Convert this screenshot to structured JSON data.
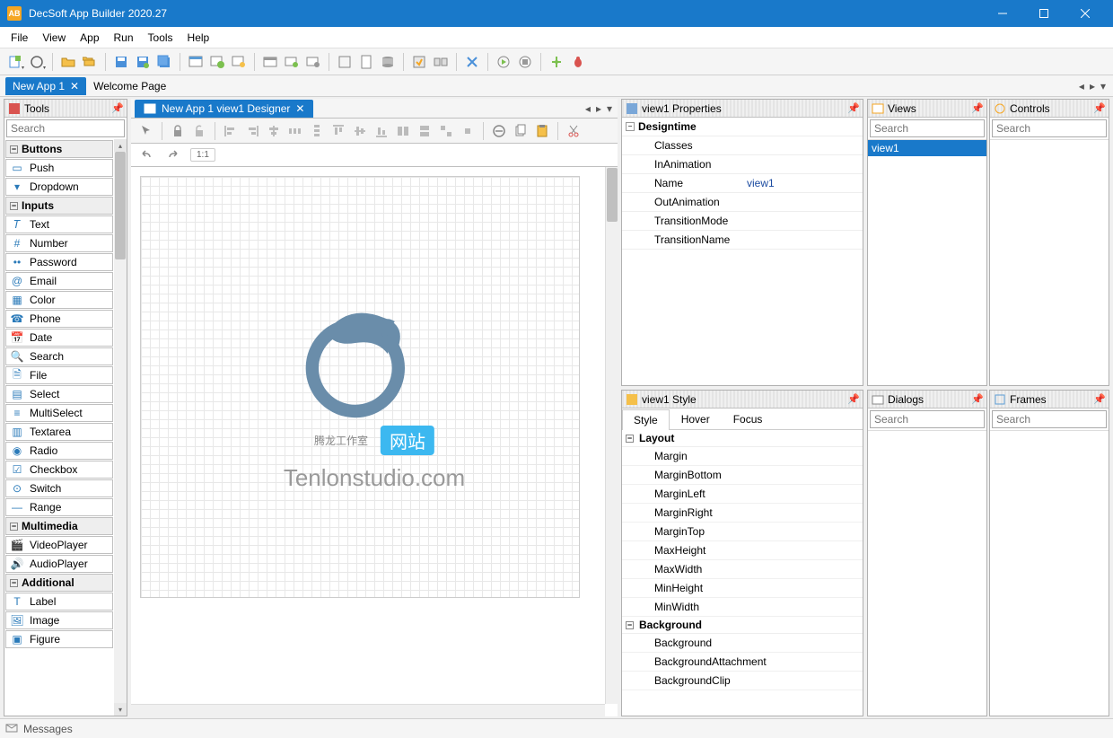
{
  "titlebar": {
    "title": "DecSoft App Builder 2020.27",
    "icon_text": "AB"
  },
  "menu": [
    "File",
    "View",
    "App",
    "Run",
    "Tools",
    "Help"
  ],
  "doc_tabs": {
    "items": [
      {
        "label": "New App 1",
        "active": true
      },
      {
        "label": "Welcome Page",
        "active": false
      }
    ]
  },
  "tools_panel": {
    "title": "Tools",
    "search_placeholder": "Search",
    "groups": [
      {
        "name": "Buttons",
        "items": [
          "Push",
          "Dropdown"
        ]
      },
      {
        "name": "Inputs",
        "items": [
          "Text",
          "Number",
          "Password",
          "Email",
          "Color",
          "Phone",
          "Date",
          "Search",
          "File",
          "Select",
          "MultiSelect",
          "Textarea",
          "Radio",
          "Checkbox",
          "Switch",
          "Range"
        ]
      },
      {
        "name": "Multimedia",
        "items": [
          "VideoPlayer",
          "AudioPlayer"
        ]
      },
      {
        "name": "Additional",
        "items": [
          "Label",
          "Image",
          "Figure"
        ]
      }
    ]
  },
  "designer": {
    "tab_label": "New App 1 view1 Designer",
    "watermark": {
      "zh": "腾龙工作室",
      "badge": "网站",
      "en": "Tenlonstudio.com"
    }
  },
  "properties_panel": {
    "title": "view1 Properties",
    "category": "Designtime",
    "rows": [
      {
        "k": "Classes",
        "v": ""
      },
      {
        "k": "InAnimation",
        "v": ""
      },
      {
        "k": "Name",
        "v": "view1"
      },
      {
        "k": "OutAnimation",
        "v": ""
      },
      {
        "k": "TransitionMode",
        "v": ""
      },
      {
        "k": "TransitionName",
        "v": ""
      }
    ]
  },
  "style_panel": {
    "title": "view1 Style",
    "tabs": [
      "Style",
      "Hover",
      "Focus"
    ],
    "active_tab": "Style",
    "sections": [
      {
        "name": "Layout",
        "items": [
          "Margin",
          "MarginBottom",
          "MarginLeft",
          "MarginRight",
          "MarginTop",
          "MaxHeight",
          "MaxWidth",
          "MinHeight",
          "MinWidth"
        ]
      },
      {
        "name": "Background",
        "items": [
          "Background",
          "BackgroundAttachment",
          "BackgroundClip"
        ]
      }
    ]
  },
  "views_panel": {
    "title": "Views",
    "search_placeholder": "Search",
    "items": [
      "view1"
    ],
    "selected": "view1"
  },
  "controls_panel": {
    "title": "Controls",
    "search_placeholder": "Search"
  },
  "dialogs_panel": {
    "title": "Dialogs",
    "search_placeholder": "Search"
  },
  "frames_panel": {
    "title": "Frames",
    "search_placeholder": "Search"
  },
  "statusbar": {
    "messages": "Messages"
  }
}
